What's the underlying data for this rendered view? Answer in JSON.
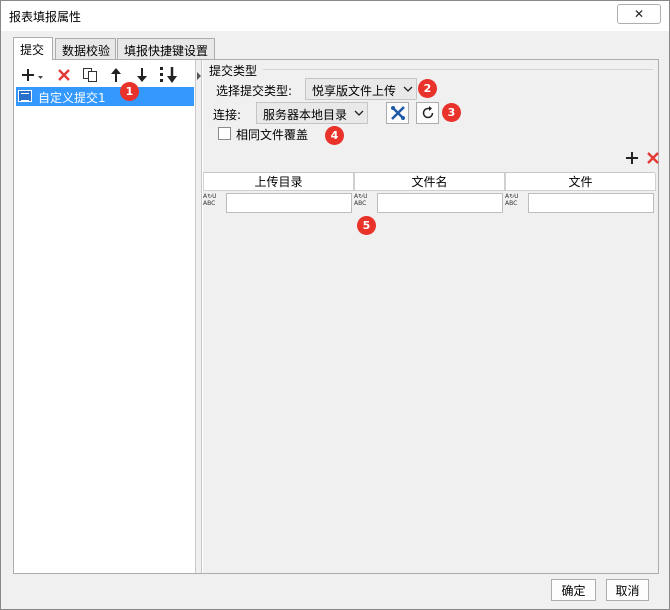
{
  "window": {
    "title": "报表填报属性",
    "close_label": "✕"
  },
  "tabs": [
    {
      "label": "提交"
    },
    {
      "label": "数据校验"
    },
    {
      "label": "填报快捷键设置"
    }
  ],
  "toolbar": {
    "icons": [
      "add-dropdown-icon",
      "delete-icon",
      "copy-icon",
      "move-up-icon",
      "move-down-icon",
      "move-bottom-icon"
    ]
  },
  "tree": {
    "items": [
      {
        "label": "自定义提交1"
      }
    ]
  },
  "submit": {
    "group_title": "提交类型",
    "type_label": "选择提交类型:",
    "type_value": "悦享版文件上传",
    "connection_label": "连接:",
    "connection_value": "服务器本地目录",
    "overwrite_label": "相同文件覆盖"
  },
  "badges": [
    "1",
    "2",
    "3",
    "4",
    "5"
  ],
  "table": {
    "columns": [
      "上传目录",
      "文件名",
      "文件"
    ],
    "cell_icon_text": [
      "A↻U",
      "ABC"
    ]
  },
  "footer": {
    "ok_label": "确定",
    "cancel_label": "取消"
  },
  "colors": {
    "selection": "#3399ff",
    "badge": "#e8322a",
    "delete": "#e53935"
  }
}
